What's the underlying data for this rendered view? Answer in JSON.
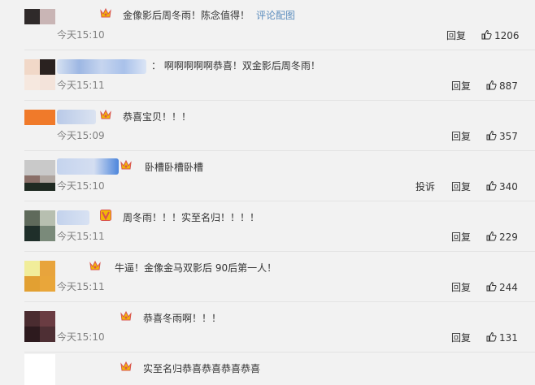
{
  "comments": [
    {
      "text": "金像影后周冬雨！陈念值得！",
      "link": "评论配图",
      "time": "今天15:10",
      "reply": "回复",
      "likes": "1206",
      "badge": "crown",
      "avatar": [
        "#2f2a2a",
        "#c9b5b5",
        "#6c6161",
        "#e6dcdc"
      ],
      "name": []
    },
    {
      "text": "：  啊啊啊啊啊恭喜！双金影后周冬雨！",
      "time": "今天15:11",
      "reply": "回复",
      "likes": "887",
      "avatar": [
        "#f1d8c8",
        "#2a2220",
        "#e5c3ad",
        "#f3e3da"
      ],
      "name": [
        "#d6e1f2",
        "#9db7e3",
        "#c6d5ef",
        "#a9c1ea",
        "#dbe5f5"
      ]
    },
    {
      "text": "恭喜宝贝！！！",
      "time": "今天15:09",
      "reply": "回复",
      "likes": "357",
      "badge": "crown",
      "avatar": [
        "#f07a2a",
        "#f07a2a",
        "#f4b38a",
        "#f2f2f2"
      ],
      "name": [
        "#b9cae8",
        "#dbe3f1"
      ]
    },
    {
      "text": "卧槽卧槽卧槽",
      "time": "今天15:10",
      "report": "投诉",
      "reply": "回复",
      "likes": "340",
      "badge": "crown",
      "avatar": [
        "#c9c9c9",
        "#b5b5b5",
        "#8a6f68",
        "#1f2a22"
      ],
      "name": [
        "#c5d4ee",
        "#d4def1",
        "#4d86dc"
      ]
    },
    {
      "text": "周冬雨！！！实至名归！！！！",
      "time": "今天15:11",
      "reply": "回复",
      "likes": "229",
      "badge": "vip",
      "avatar": [
        "#5f6a5b",
        "#b7bfb0",
        "#1f2f2a",
        "#7a8a7a"
      ],
      "name": [
        "#c3d2ec",
        "#d8e2f3"
      ]
    },
    {
      "text": "牛逼！金像金马双影后 90后第一人！",
      "time": "今天15:11",
      "reply": "回复",
      "likes": "244",
      "badge": "crown",
      "avatar": [
        "#f1ed9a",
        "#e8a43c",
        "#e2a032",
        "#e9a63a"
      ],
      "name": []
    },
    {
      "text": "恭喜冬雨啊！！！",
      "time": "今天15:10",
      "reply": "回复",
      "likes": "131",
      "badge": "crown",
      "avatar": [
        "#4a2c30",
        "#6a3c42",
        "#2d1a1e",
        "#4e2f34"
      ],
      "name": []
    },
    {
      "text": "实至名归恭喜恭喜恭喜恭喜",
      "badge": "crown",
      "avatar": [
        "#f7f7f7",
        "#ffffff",
        "#ffffff",
        "#ffffff"
      ],
      "name": []
    }
  ]
}
